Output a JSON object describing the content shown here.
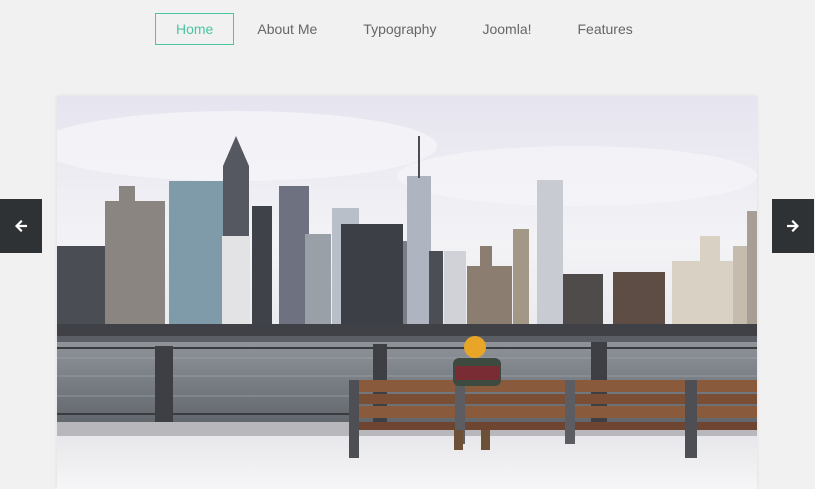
{
  "nav": {
    "items": [
      {
        "label": "Home",
        "active": true
      },
      {
        "label": "About Me",
        "active": false
      },
      {
        "label": "Typography",
        "active": false
      },
      {
        "label": "Joomla!",
        "active": false
      },
      {
        "label": "Features",
        "active": false
      }
    ]
  },
  "slider": {
    "prev_icon": "arrow-left-icon",
    "next_icon": "arrow-right-icon"
  },
  "colors": {
    "accent": "#4cc5a4",
    "arrow_bg": "#2f3234",
    "page_bg": "#f1f1f1"
  }
}
